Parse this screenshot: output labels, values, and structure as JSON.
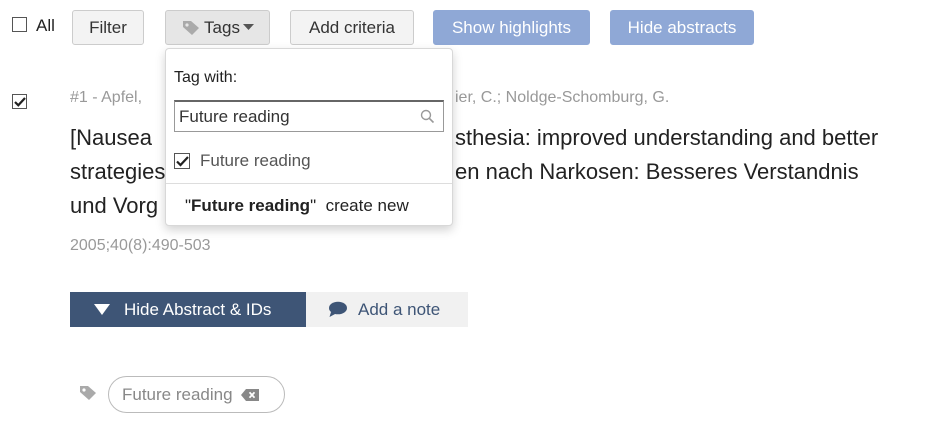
{
  "toolbar": {
    "select_all_label": "All",
    "filter_label": "Filter",
    "tags_label": "Tags",
    "add_criteria_label": "Add criteria",
    "show_highlights_label": "Show highlights",
    "hide_abstracts_label": "Hide abstracts"
  },
  "tag_dropdown": {
    "heading": "Tag with:",
    "search_value": "Future reading",
    "search_placeholder": "",
    "option_label": "Future reading",
    "option_checked": true,
    "create_prefix": "\"",
    "create_tag": "Future reading",
    "create_suffix": "\"",
    "create_action": "create new"
  },
  "record": {
    "checked": true,
    "meta_start": "#1 - Apfel,",
    "meta_end": "ier, C.; Noldge-Schomburg, G.",
    "title_line1_start": "[Nausea",
    "title_line1_end": "sthesia: improved understanding and better",
    "title_line2_start": "strategies",
    "title_line2_end": "en nach Narkosen: Besseres Verstandnis",
    "title_line3_start": "und Vorg",
    "citation": "2005;40(8):490-503",
    "hide_abstract_label": "Hide Abstract & IDs",
    "add_note_label": "Add a note",
    "tags": [
      "Future reading"
    ]
  },
  "colors": {
    "accent_blue": "#8fa8d6",
    "dark_navy": "#3e5576",
    "muted_text": "#999999"
  }
}
